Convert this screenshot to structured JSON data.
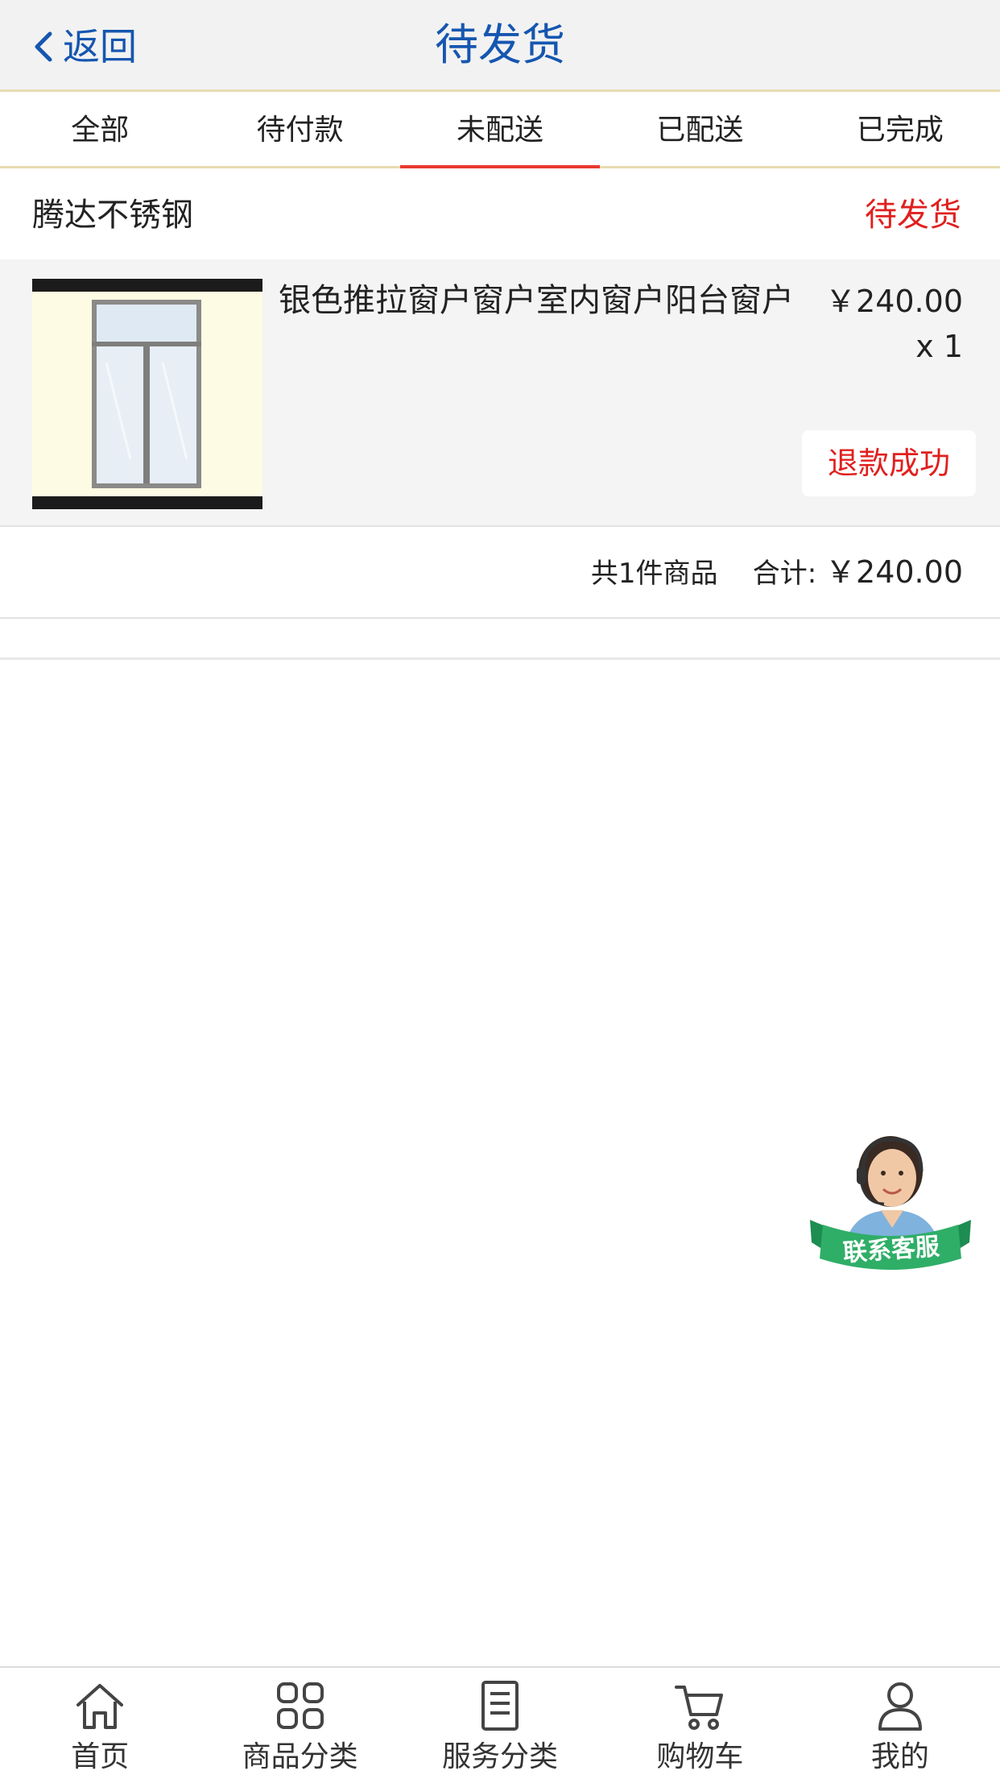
{
  "header": {
    "back_label": "返回",
    "title": "待发货"
  },
  "tabs": [
    {
      "label": "全部"
    },
    {
      "label": "待付款"
    },
    {
      "label": "未配送",
      "active": true
    },
    {
      "label": "已配送"
    },
    {
      "label": "已完成"
    }
  ],
  "order": {
    "shop_name": "腾达不锈钢",
    "status": "待发货",
    "item": {
      "title": "银色推拉窗户窗户室内窗户阳台窗户",
      "price": "￥240.00",
      "qty": "x 1",
      "action_label": "退款成功"
    },
    "summary": {
      "count_text": "共1件商品",
      "total_label": "合计:",
      "total_value": "￥240.00"
    }
  },
  "customer_service": {
    "label": "联系客服"
  },
  "bottom_nav": [
    {
      "label": "首页",
      "icon": "home-icon"
    },
    {
      "label": "商品分类",
      "icon": "grid-icon"
    },
    {
      "label": "服务分类",
      "icon": "document-icon"
    },
    {
      "label": "购物车",
      "icon": "cart-icon"
    },
    {
      "label": "我的",
      "icon": "user-icon"
    }
  ],
  "colors": {
    "accent_blue": "#1556b0",
    "status_red": "#e0201f",
    "tab_underline": "#e8392d",
    "header_border": "#e7dcb0"
  }
}
